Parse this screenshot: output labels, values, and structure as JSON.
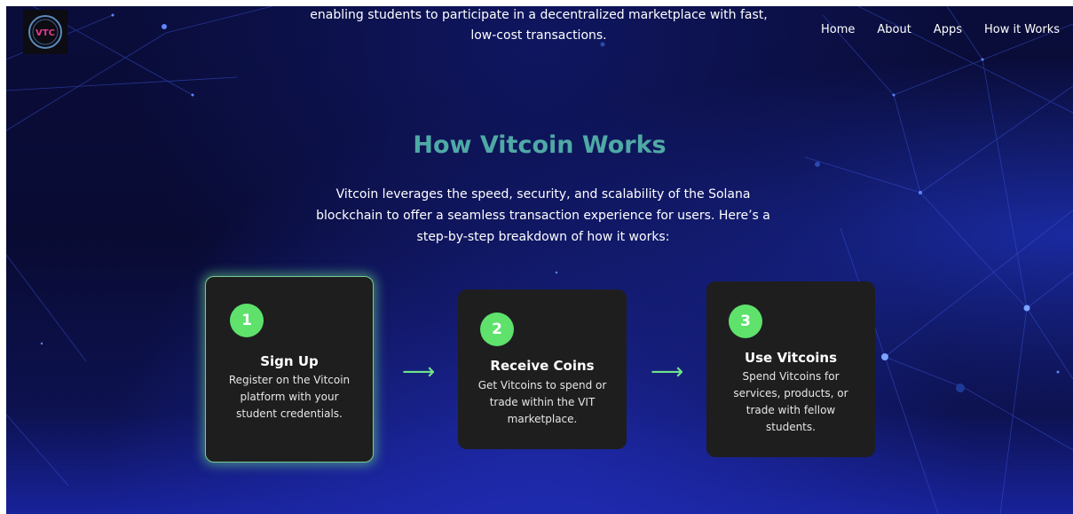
{
  "logo": {
    "text": "VTC"
  },
  "nav": [
    "Home",
    "About",
    "Apps",
    "How it Works"
  ],
  "intro": {
    "line1": "enabling students to participate in a decentralized marketplace with fast,",
    "line2": "low-cost transactions."
  },
  "section": {
    "title": "How Vitcoin Works",
    "description": "Vitcoin leverages the speed, security, and scalability of the Solana blockchain to offer a seamless transaction experience for users. Here’s a step-by-step breakdown of how it works:"
  },
  "steps": [
    {
      "number": "1",
      "title": "Sign Up",
      "text": "Register on the Vitcoin platform with your student credentials."
    },
    {
      "number": "2",
      "title": "Receive Coins",
      "text": "Get Vitcoins to spend or trade within the VIT marketplace."
    },
    {
      "number": "3",
      "title": "Use Vitcoins",
      "text": "Spend Vitcoins for services, products, or trade with fellow students."
    }
  ],
  "arrow_icon": "arrow-right-icon",
  "colors": {
    "accent_teal": "#4fa9a5",
    "badge_green": "#5ee26c",
    "card_bg": "#1e1e1f"
  }
}
